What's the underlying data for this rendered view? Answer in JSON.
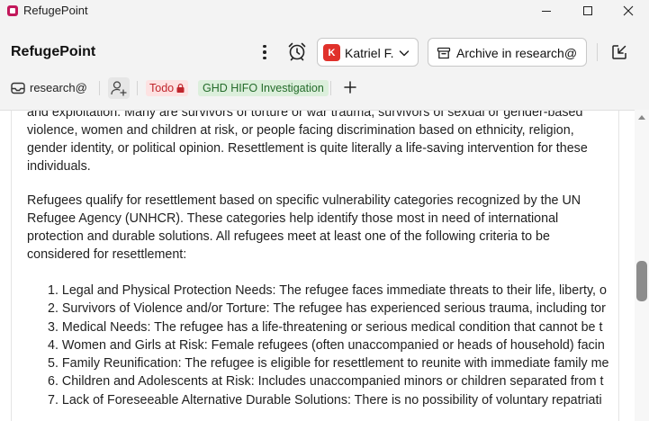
{
  "window": {
    "title": "RefugePoint"
  },
  "header": {
    "brand": "RefugePoint",
    "user": {
      "initial": "K",
      "name": "Katriel F.",
      "color": "#e0312b"
    },
    "archive_label": "Archive in research@"
  },
  "tagbar": {
    "inbox": "research@",
    "tags": [
      {
        "label": "Todo",
        "color": "#c0262d",
        "bg": "#fde2e2",
        "icon": "lock-icon"
      },
      {
        "label": "GHD HIFO Investigation",
        "color": "#246b2a",
        "bg": "#dcefdc"
      }
    ]
  },
  "document": {
    "paragraph1_lines": [
      "and exploitation. Many are survivors of torture or war trauma, survivors of sexual or gender-based",
      "violence, women and children at risk, or people facing discrimination based on ethnicity, religion,",
      "gender identity, or political opinion. Resettlement is quite literally a life-saving intervention for these",
      "individuals."
    ],
    "paragraph2_lines": [
      "Refugees qualify for resettlement based on specific vulnerability categories recognized by the UN",
      "Refugee Agency (UNHCR). These categories help identify those most in need of international",
      "protection and durable solutions. All refugees meet at least one of the following criteria to be",
      "considered for resettlement:"
    ],
    "criteria": [
      "1. Legal and Physical Protection Needs: The refugee faces immediate threats to their life, liberty, o",
      "2. Survivors of Violence and/or Torture: The refugee has experienced serious trauma, including tor",
      "3. Medical Needs: The refugee has a life-threatening or serious medical condition that cannot be t",
      "4. Women and Girls at Risk: Female refugees (often unaccompanied or heads of household) facin",
      "5. Family Reunification: The refugee is eligible for resettlement to reunite with immediate family me",
      "6. Children and Adolescents at Risk: Includes unaccompanied minors or children separated from t",
      "7. Lack of Foreseeable Alternative Durable Solutions: There is no possibility of voluntary repatriati"
    ]
  }
}
